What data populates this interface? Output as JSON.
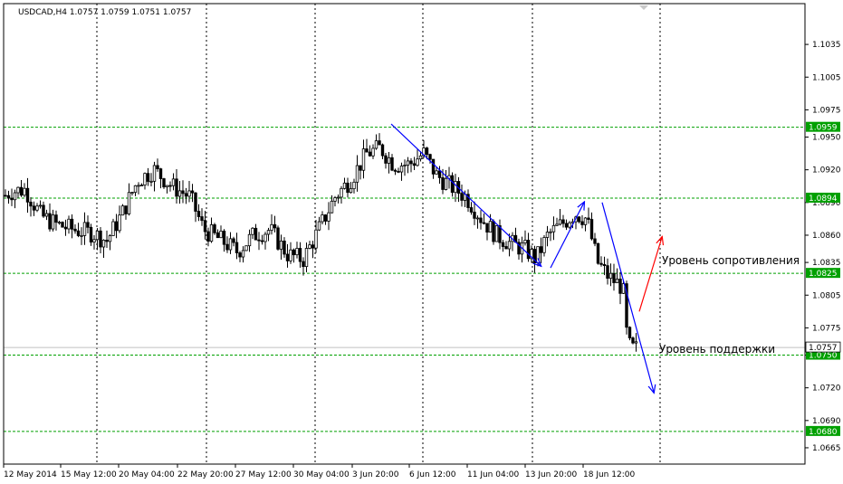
{
  "header": {
    "symbol_line": "USDCAD,H4  1.0757 1.0759 1.0751 1.0757"
  },
  "colors": {
    "background": "#ffffff",
    "candle_bull": "#ffffff",
    "candle_bear": "#000000",
    "level_line": "#00a000",
    "level_badge": "#00a000",
    "arrow_blue": "#0000ff",
    "arrow_red": "#ff0000",
    "grid": "#000000"
  },
  "annotations": {
    "resistance_label": "Уровень сопротивления",
    "support_label": "Уровень поддержки"
  },
  "chart_data": {
    "type": "candlestick",
    "symbol": "USDCAD",
    "timeframe": "H4",
    "ylim": [
      1.0655,
      1.1055
    ],
    "y_ticks": [
      "1.1035",
      "1.1005",
      "1.0975",
      "1.0950",
      "1.0920",
      "1.0890",
      "1.0860",
      "1.0835",
      "1.0805",
      "1.0775",
      "1.0750",
      "1.0720",
      "1.0690",
      "1.0665"
    ],
    "x_ticks": [
      "12 May 2014",
      "15 May 12:00",
      "20 May 04:00",
      "22 May 20:00",
      "27 May 12:00",
      "30 May 04:00",
      "3 Jun 20:00",
      "6 Jun 12:00",
      "11 Jun 04:00",
      "13 Jun 20:00",
      "18 Jun 12:00"
    ],
    "levels": [
      {
        "label": "1.0959",
        "value": 1.0959
      },
      {
        "label": "1.0894",
        "value": 1.0894
      },
      {
        "label": "1.0825",
        "value": 1.0825
      },
      {
        "label": "1.0750",
        "value": 1.075
      },
      {
        "label": "1.0680",
        "value": 1.068
      }
    ],
    "current_price": {
      "label": "1.0757",
      "value": 1.0757
    },
    "close_path": [
      [
        0,
        1.0893
      ],
      [
        12,
        1.09
      ],
      [
        28,
        1.0902
      ],
      [
        45,
        1.0878
      ],
      [
        62,
        1.087
      ],
      [
        82,
        1.0865
      ],
      [
        102,
        1.0862
      ],
      [
        118,
        1.0855
      ],
      [
        135,
        1.088
      ],
      [
        152,
        1.091
      ],
      [
        170,
        1.092
      ],
      [
        190,
        1.0905
      ],
      [
        210,
        1.0895
      ],
      [
        225,
        1.0865
      ],
      [
        245,
        1.0855
      ],
      [
        262,
        1.0845
      ],
      [
        280,
        1.086
      ],
      [
        298,
        1.0865
      ],
      [
        318,
        1.0842
      ],
      [
        335,
        1.0838
      ],
      [
        352,
        1.0865
      ],
      [
        370,
        1.0895
      ],
      [
        388,
        1.0912
      ],
      [
        405,
        1.0935
      ],
      [
        420,
        1.094
      ],
      [
        435,
        1.0925
      ],
      [
        452,
        1.0925
      ],
      [
        468,
        1.0935
      ],
      [
        482,
        1.0915
      ],
      [
        498,
        1.0905
      ],
      [
        515,
        1.0895
      ],
      [
        532,
        1.0875
      ],
      [
        548,
        1.086
      ],
      [
        565,
        1.0852
      ],
      [
        580,
        1.0847
      ],
      [
        592,
        1.0838
      ],
      [
        605,
        1.086
      ],
      [
        620,
        1.087
      ],
      [
        635,
        1.088
      ],
      [
        648,
        1.0875
      ],
      [
        660,
        1.0835
      ],
      [
        672,
        1.0822
      ],
      [
        688,
        1.0812
      ],
      [
        693,
        1.076
      ],
      [
        700,
        1.0755
      ],
      [
        705,
        1.0757
      ]
    ],
    "trend_arrows": [
      {
        "color": "blue",
        "from": [
          432,
          1.0962
        ],
        "to": [
          597,
          1.0832
        ]
      },
      {
        "color": "blue",
        "from": [
          608,
          1.083
        ],
        "to": [
          645,
          1.089
        ]
      },
      {
        "color": "blue",
        "from": [
          665,
          1.089
        ],
        "to": [
          722,
          1.0716
        ]
      },
      {
        "color": "red",
        "from": [
          706,
          1.079
        ],
        "to": [
          731,
          1.0858
        ]
      }
    ]
  }
}
